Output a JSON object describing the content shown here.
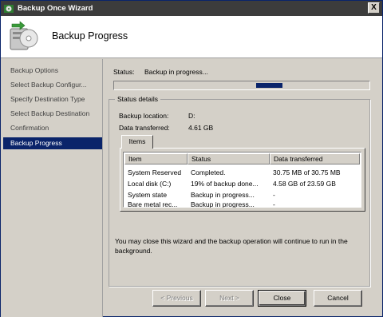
{
  "window": {
    "title": "Backup Once Wizard",
    "close_label": "X"
  },
  "header": {
    "title": "Backup Progress"
  },
  "sidebar": {
    "items": [
      {
        "label": "Backup Options"
      },
      {
        "label": "Select Backup Configur..."
      },
      {
        "label": "Specify Destination Type"
      },
      {
        "label": "Select Backup Destination"
      },
      {
        "label": "Confirmation"
      },
      {
        "label": "Backup Progress",
        "active": true
      }
    ]
  },
  "status": {
    "label": "Status:",
    "value": "Backup in progress...",
    "progress_indeterminate": true
  },
  "details": {
    "group_title": "Status details",
    "location_label": "Backup location:",
    "location_value": "D:",
    "transferred_label": "Data transferred:",
    "transferred_value": "4.61 GB"
  },
  "tabs": [
    {
      "label": "Items"
    }
  ],
  "items_table": {
    "columns": [
      "Item",
      "Status",
      "Data transferred"
    ],
    "rows": [
      [
        "System Reserved",
        "Completed.",
        "30.75 MB of 30.75 MB"
      ],
      [
        "Local disk (C:)",
        "19% of backup done...",
        "4.58 GB of 23.59 GB"
      ],
      [
        "System state",
        "Backup in progress...",
        "-"
      ],
      [
        "Bare metal rec...",
        "Backup in progress...",
        "-"
      ]
    ]
  },
  "note": "You may close this wizard and the backup operation will continue to run in the background.",
  "buttons": {
    "previous": "< Previous",
    "next": "Next >",
    "close": "Close",
    "cancel": "Cancel"
  },
  "colors": {
    "selection": "#0a246a",
    "face": "#d4d0c8",
    "title_bar": "#3c3c3c"
  }
}
